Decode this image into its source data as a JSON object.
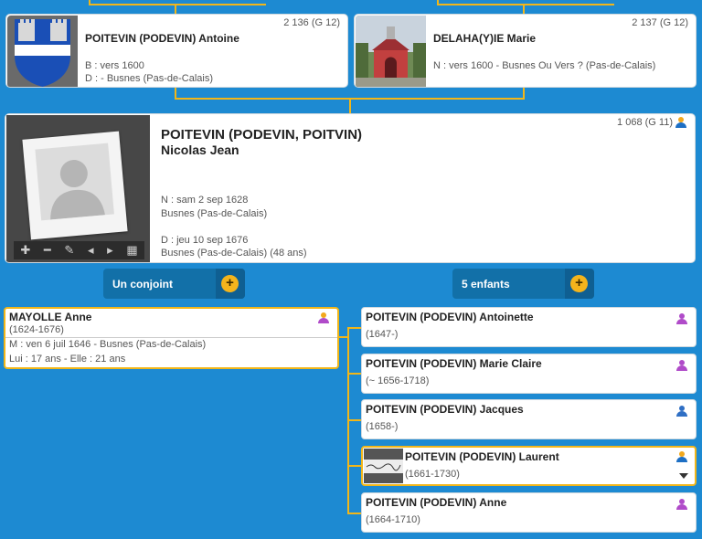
{
  "colors": {
    "background": "#1d8ad2",
    "accent": "#f2b619",
    "male_icon": "#2f6fc4",
    "female_icon": "#b04bc9",
    "self_icon": "#f2a81c"
  },
  "father": {
    "name": "POITEVIN (PODEVIN) Antoine",
    "sosa": "2 136 (G 12)",
    "birth": "B : vers 1600",
    "death": "D :  - Busnes (Pas-de-Calais)",
    "photo": "coat-of-arms"
  },
  "mother": {
    "name": "DELAHA(Y)IE Marie",
    "sosa": "2 137 (G 12)",
    "birth": "N : vers 1600 - Busnes Ou Vers ? (Pas-de-Calais)",
    "photo": "chapel-photo"
  },
  "main": {
    "surname": "POITEVIN (PODEVIN, POITVIN)",
    "given": "Nicolas Jean",
    "sosa": "1 068 (G 11)",
    "birth_date": "N : sam 2 sep 1628",
    "birth_place": "Busnes (Pas-de-Calais)",
    "death_date": "D : jeu 10 sep 1676",
    "death_place": "Busnes (Pas-de-Calais) (48 ans)",
    "toolbar": [
      "plus-icon",
      "minus-icon",
      "pencil-icon",
      "prev-icon",
      "next-icon",
      "film-icon"
    ]
  },
  "spouses_button": {
    "label": "Un conjoint",
    "action": "+"
  },
  "children_button": {
    "label": "5 enfants",
    "action": "+"
  },
  "spouse": {
    "name": "MAYOLLE Anne",
    "dates": "(1624-1676)",
    "marriage": "M : ven 6 juil 1646 - Busnes (Pas-de-Calais)",
    "ages": "Lui : 17 ans - Elle : 21 ans"
  },
  "children": [
    {
      "name": "POITEVIN (PODEVIN) Antoinette",
      "dates": "(1647-)",
      "gender": "female"
    },
    {
      "name": "POITEVIN (PODEVIN) Marie Claire",
      "dates": "(~ 1656-1718)",
      "gender": "female"
    },
    {
      "name": "POITEVIN (PODEVIN) Jacques",
      "dates": "(1658-)",
      "gender": "male"
    },
    {
      "name": "POITEVIN (PODEVIN) Laurent",
      "dates": "(1661-1730)",
      "gender": "male-direct"
    },
    {
      "name": "POITEVIN (PODEVIN) Anne",
      "dates": "(1664-1710)",
      "gender": "female"
    }
  ]
}
